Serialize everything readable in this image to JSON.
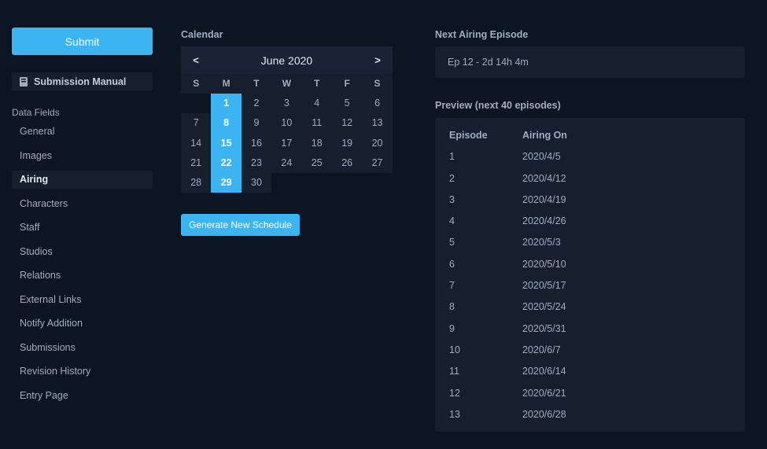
{
  "sidebar": {
    "submit_label": "Submit",
    "manual_label": "Submission Manual",
    "fields_heading": "Data Fields",
    "items": [
      {
        "label": "General"
      },
      {
        "label": "Images"
      },
      {
        "label": "Airing",
        "active": true
      },
      {
        "label": "Characters"
      },
      {
        "label": "Staff"
      },
      {
        "label": "Studios"
      },
      {
        "label": "Relations"
      },
      {
        "label": "External Links"
      },
      {
        "label": "Notify Addition"
      },
      {
        "label": "Submissions"
      },
      {
        "label": "Revision History"
      },
      {
        "label": "Entry Page"
      }
    ]
  },
  "calendar": {
    "title": "Calendar",
    "prev_label": "<",
    "next_label": ">",
    "month_label": "June 2020",
    "weekdays": [
      "S",
      "M",
      "T",
      "W",
      "T",
      "F",
      "S"
    ],
    "leading_blank_days": 1,
    "days_in_month": 30,
    "selected_days": [
      1,
      8,
      15,
      22,
      29
    ]
  },
  "generate_label": "Generate New Schedule",
  "next_airing": {
    "title": "Next Airing Episode",
    "value": "Ep 12 - 2d 14h 4m"
  },
  "preview": {
    "title": "Preview (next 40 episodes)",
    "col_episode": "Episode",
    "col_airing": "Airing On",
    "rows": [
      {
        "episode": "1",
        "date": "2020/4/5"
      },
      {
        "episode": "2",
        "date": "2020/4/12"
      },
      {
        "episode": "3",
        "date": "2020/4/19"
      },
      {
        "episode": "4",
        "date": "2020/4/26"
      },
      {
        "episode": "5",
        "date": "2020/5/3"
      },
      {
        "episode": "6",
        "date": "2020/5/10"
      },
      {
        "episode": "7",
        "date": "2020/5/17"
      },
      {
        "episode": "8",
        "date": "2020/5/24"
      },
      {
        "episode": "9",
        "date": "2020/5/31"
      },
      {
        "episode": "10",
        "date": "2020/6/7"
      },
      {
        "episode": "11",
        "date": "2020/6/14"
      },
      {
        "episode": "12",
        "date": "2020/6/21"
      },
      {
        "episode": "13",
        "date": "2020/6/28"
      }
    ]
  },
  "colors": {
    "background": "#0b1622",
    "panel": "#151f2e",
    "accent": "#3db4f2"
  },
  "icons": {
    "manual": "book-icon"
  }
}
